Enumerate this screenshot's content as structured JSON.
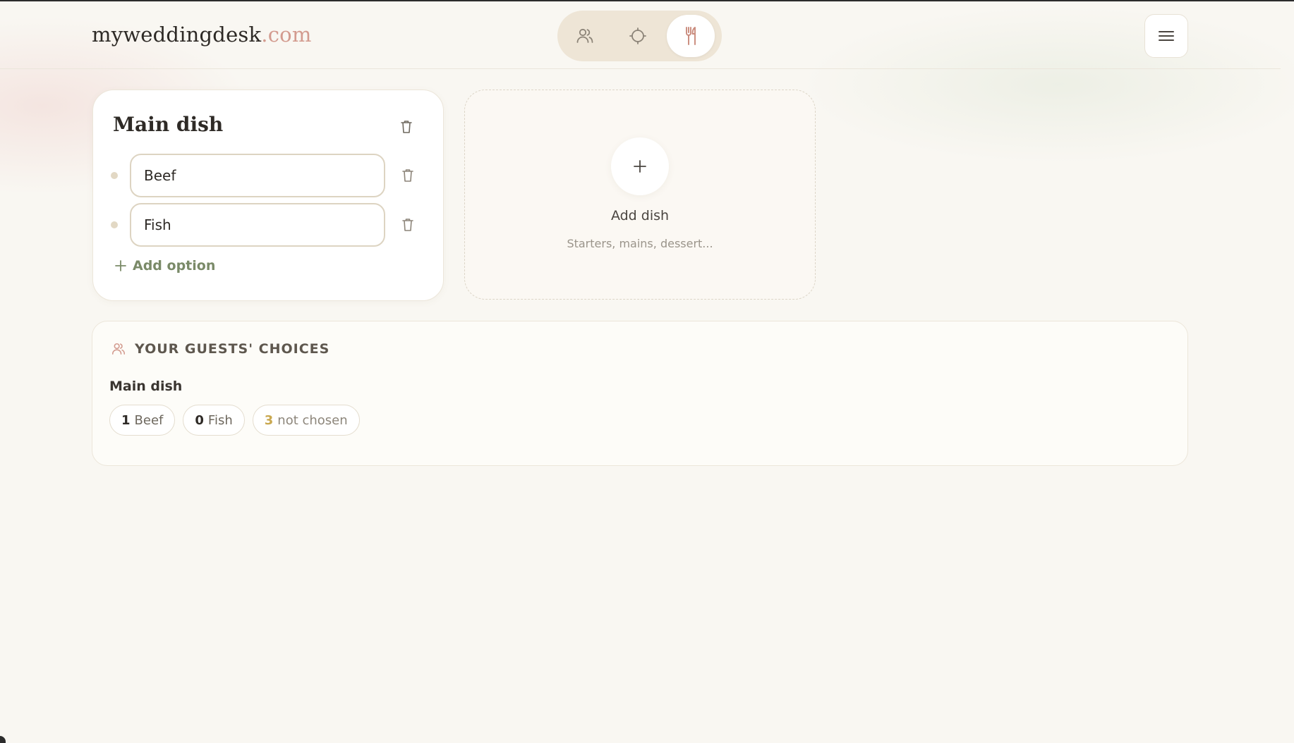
{
  "header": {
    "logo_name": "myweddingdesk",
    "logo_tld": ".com",
    "modes": [
      {
        "icon": "guests-icon",
        "active": false
      },
      {
        "icon": "rings-icon",
        "active": false
      },
      {
        "icon": "cutlery-icon",
        "active": true
      }
    ],
    "menu_icon": "hamburger-icon"
  },
  "dish": {
    "title": "Main dish",
    "options": [
      {
        "value": "Beef"
      },
      {
        "value": "Fish"
      }
    ],
    "add_option_label": "Add option"
  },
  "add_dish": {
    "title": "Add dish",
    "subtitle": "Starters, mains, dessert..."
  },
  "choices": {
    "title": "YOUR GUESTS' CHOICES",
    "groups": [
      {
        "label": "Main dish",
        "chips": [
          {
            "count": "1",
            "label": "Beef"
          },
          {
            "count": "0",
            "label": "Fish"
          },
          {
            "count": "3",
            "label": "not chosen"
          }
        ]
      }
    ]
  },
  "colors": {
    "accent_rose": "#d39b8f",
    "accent_sage": "#7a8a68",
    "pending_gold": "#c9a850",
    "background": "#f9f7f2"
  }
}
